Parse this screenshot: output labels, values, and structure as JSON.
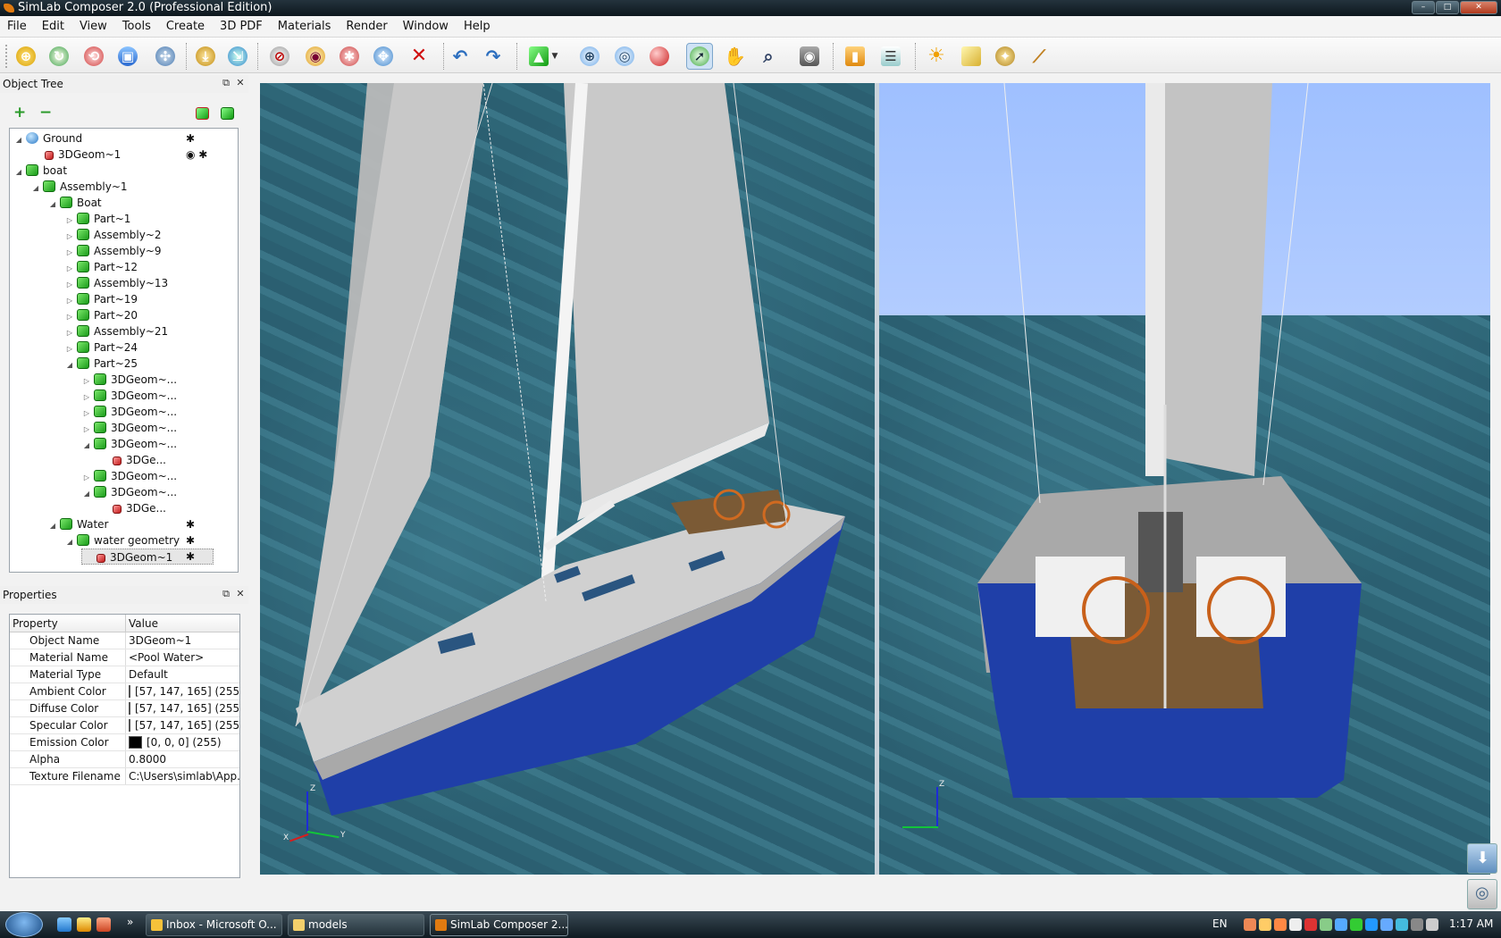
{
  "window": {
    "title": "SimLab Composer 2.0  (Professional Edition)",
    "min": "–",
    "max": "□",
    "close": "✕"
  },
  "menu": [
    "File",
    "Edit",
    "View",
    "Tools",
    "Create",
    "3D PDF",
    "Materials",
    "Render",
    "Window",
    "Help"
  ],
  "toolbar": {
    "icons": [
      "zoom-fit-icon",
      "orbit-icon",
      "rotate-icon",
      "move-object-icon",
      "transform-icon",
      "drop-to-ground-icon",
      "align-icon",
      "hide-icon",
      "show-icon",
      "no-shadow-icon",
      "explode-icon",
      "delete-icon",
      "undo-icon",
      "redo-icon",
      "add-geometry-icon",
      "select-center-icon",
      "target-icon",
      "render-sphere-icon",
      "select-tool-icon",
      "pan-hand-icon",
      "zoom-icon",
      "camera-icon",
      "paint-bucket-icon",
      "materials-list-icon",
      "sun-light-icon",
      "area-light-icon",
      "spot-light-icon",
      "wand-icon"
    ]
  },
  "object_tree": {
    "title": "Object Tree",
    "add": "+",
    "remove": "−",
    "nodes": [
      {
        "label": "Ground",
        "level": 0,
        "arrow": "◢",
        "icon": "globe",
        "flags": "✱"
      },
      {
        "label": "3DGeom~1",
        "level": 1,
        "arrow": "",
        "icon": "geom",
        "flags": "◉ ✱"
      },
      {
        "label": "boat",
        "level": 0,
        "arrow": "◢",
        "icon": "cube",
        "flags": ""
      },
      {
        "label": "Assembly~1",
        "level": 1,
        "arrow": "◢",
        "icon": "cube",
        "flags": ""
      },
      {
        "label": "Boat",
        "level": 2,
        "arrow": "◢",
        "icon": "cube",
        "flags": ""
      },
      {
        "label": "Part~1",
        "level": 3,
        "arrow": "▷",
        "icon": "cube",
        "flags": ""
      },
      {
        "label": "Assembly~2",
        "level": 3,
        "arrow": "▷",
        "icon": "cube",
        "flags": ""
      },
      {
        "label": "Assembly~9",
        "level": 3,
        "arrow": "▷",
        "icon": "cube",
        "flags": ""
      },
      {
        "label": "Part~12",
        "level": 3,
        "arrow": "▷",
        "icon": "cube",
        "flags": ""
      },
      {
        "label": "Assembly~13",
        "level": 3,
        "arrow": "▷",
        "icon": "cube",
        "flags": ""
      },
      {
        "label": "Part~19",
        "level": 3,
        "arrow": "▷",
        "icon": "cube",
        "flags": ""
      },
      {
        "label": "Part~20",
        "level": 3,
        "arrow": "▷",
        "icon": "cube",
        "flags": ""
      },
      {
        "label": "Assembly~21",
        "level": 3,
        "arrow": "▷",
        "icon": "cube",
        "flags": ""
      },
      {
        "label": "Part~24",
        "level": 3,
        "arrow": "▷",
        "icon": "cube",
        "flags": ""
      },
      {
        "label": "Part~25",
        "level": 3,
        "arrow": "◢",
        "icon": "cube",
        "flags": ""
      },
      {
        "label": "3DGeom~...",
        "level": 4,
        "arrow": "▷",
        "icon": "cube",
        "flags": ""
      },
      {
        "label": "3DGeom~...",
        "level": 4,
        "arrow": "▷",
        "icon": "cube",
        "flags": ""
      },
      {
        "label": "3DGeom~...",
        "level": 4,
        "arrow": "▷",
        "icon": "cube",
        "flags": ""
      },
      {
        "label": "3DGeom~...",
        "level": 4,
        "arrow": "▷",
        "icon": "cube",
        "flags": ""
      },
      {
        "label": "3DGeom~...",
        "level": 4,
        "arrow": "◢",
        "icon": "cube",
        "flags": ""
      },
      {
        "label": "3DGe...",
        "level": 5,
        "arrow": "",
        "icon": "geom",
        "flags": ""
      },
      {
        "label": "3DGeom~...",
        "level": 4,
        "arrow": "▷",
        "icon": "cube",
        "flags": ""
      },
      {
        "label": "3DGeom~...",
        "level": 4,
        "arrow": "◢",
        "icon": "cube",
        "flags": ""
      },
      {
        "label": "3DGe...",
        "level": 5,
        "arrow": "",
        "icon": "geom",
        "flags": ""
      },
      {
        "label": "Water",
        "level": 2,
        "arrow": "◢",
        "icon": "cube",
        "flags": "✱"
      },
      {
        "label": "water geometry",
        "level": 3,
        "arrow": "◢",
        "icon": "cube",
        "flags": "✱"
      },
      {
        "label": "3DGeom~1",
        "level": 4,
        "arrow": "",
        "icon": "geom",
        "flags": "✱",
        "selected": true
      }
    ]
  },
  "properties": {
    "title": "Properties",
    "col_property": "Property",
    "col_value": "Value",
    "rows": [
      {
        "name": "Object Name",
        "value": "3DGeom~1",
        "swatch": null
      },
      {
        "name": "Material Name",
        "value": "<Pool Water>",
        "swatch": null
      },
      {
        "name": "Material Type",
        "value": "Default",
        "swatch": null
      },
      {
        "name": "Ambient Color",
        "value": "[57, 147, 165] (255)",
        "swatch": "#3993a5"
      },
      {
        "name": "Diffuse Color",
        "value": "[57, 147, 165] (255)",
        "swatch": "#3993a5"
      },
      {
        "name": "Specular Color",
        "value": "[57, 147, 165] (255)",
        "swatch": "#3993a5"
      },
      {
        "name": "Emission Color",
        "value": "[0, 0, 0] (255)",
        "swatch": "#000000"
      },
      {
        "name": "Alpha",
        "value": "0.8000",
        "swatch": null
      },
      {
        "name": "Texture Filename",
        "value": "C:\\Users\\simlab\\App...",
        "swatch": null
      }
    ]
  },
  "viewport": {
    "axis_z": "Z",
    "axis_y": "Y",
    "axis_x": "X"
  },
  "taskbar": {
    "items": [
      "Inbox - Microsoft O...",
      "models",
      "SimLab Composer 2..."
    ],
    "lang": "EN",
    "clock": "1:17 AM",
    "show_more": "»"
  },
  "colors": {
    "accent": "#3993a5",
    "hull": "#1f3fa8",
    "sea": "#2f6a7b",
    "sky": "#a8c4ff"
  }
}
